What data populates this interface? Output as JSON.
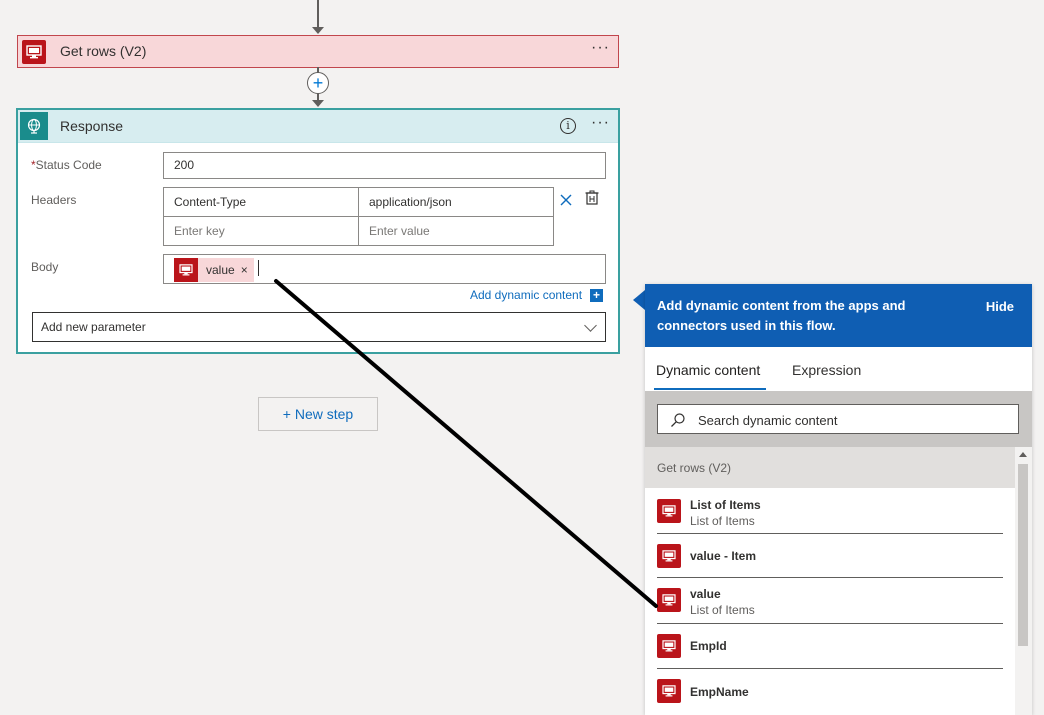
{
  "get_rows": {
    "title": "Get rows (V2)",
    "menu": "···"
  },
  "response": {
    "title": "Response",
    "menu": "···",
    "info": "i",
    "status_code": {
      "required_mark": "*",
      "label": "Status Code",
      "value": "200"
    },
    "headers": {
      "label": "Headers",
      "rows": [
        {
          "key": "Content-Type",
          "value": "application/json"
        }
      ],
      "key_placeholder": "Enter key",
      "value_placeholder": "Enter value"
    },
    "body": {
      "label": "Body",
      "token_label": "value",
      "token_remove": "×"
    },
    "add_dynamic_content": "Add dynamic content",
    "add_dynamic_icon": "+",
    "add_parameter_placeholder": "Add new parameter"
  },
  "plus_button": "+",
  "new_step": "+ New step",
  "dynamic_panel": {
    "header_text": "Add dynamic content from the apps and connectors used in this flow.",
    "hide": "Hide",
    "tabs": [
      {
        "label": "Dynamic content",
        "active": true
      },
      {
        "label": "Expression",
        "active": false
      }
    ],
    "search_placeholder": "Search dynamic content",
    "group_label": "Get rows (V2)",
    "items": [
      {
        "title": "List of Items",
        "subtitle": "List of Items"
      },
      {
        "title": "value - Item",
        "subtitle": ""
      },
      {
        "title": "value",
        "subtitle": "List of Items"
      },
      {
        "title": "EmpId",
        "subtitle": ""
      },
      {
        "title": "EmpName",
        "subtitle": ""
      }
    ]
  },
  "colors": {
    "sql_red": "#ba141a",
    "response_teal": "#1a8c8c",
    "panel_blue": "#0f5eb3",
    "link_blue": "#0f6cbd"
  },
  "icons": {
    "sql": "sql-connector-icon",
    "response": "globe-icon",
    "search": "search-icon",
    "delete": "delete-icon",
    "clear": "close-icon"
  }
}
